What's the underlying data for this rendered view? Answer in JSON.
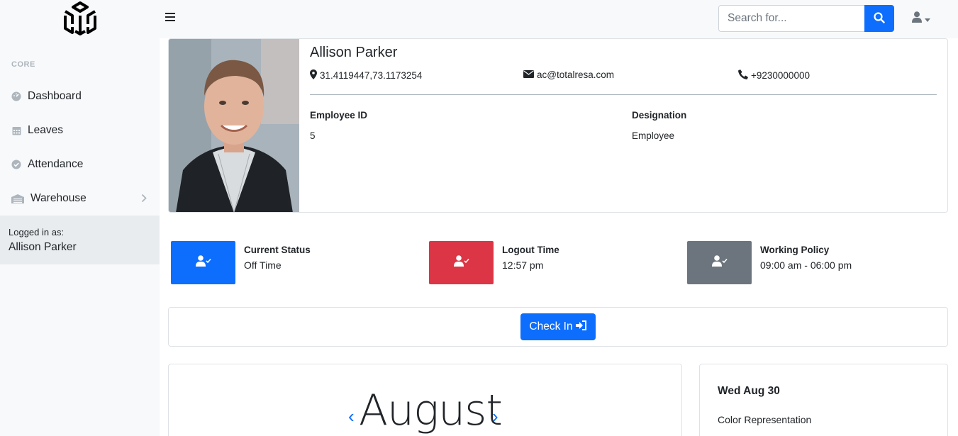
{
  "sidebar": {
    "heading": "CORE",
    "items": [
      {
        "label": "Dashboard",
        "icon": "tachometer-icon"
      },
      {
        "label": "Leaves",
        "icon": "calendar-icon"
      },
      {
        "label": "Attendance",
        "icon": "check-circle-icon"
      },
      {
        "label": "Warehouse",
        "icon": "warehouse-icon"
      }
    ],
    "logged_label": "Logged in as:",
    "logged_user": "Allison Parker"
  },
  "topbar": {
    "search_placeholder": "Search for..."
  },
  "profile": {
    "name": "Allison Parker",
    "location": "31.4119447,73.1173254",
    "email": "ac@totalresa.com",
    "phone": "+9230000000",
    "employee_id_label": "Employee ID",
    "employee_id": "5",
    "designation_label": "Designation",
    "designation": "Employee"
  },
  "status": [
    {
      "title": "Current Status",
      "value": "Off Time",
      "color": "#0d6efd"
    },
    {
      "title": "Logout Time",
      "value": "12:57 pm",
      "color": "#dc3545"
    },
    {
      "title": "Working Policy",
      "value": "09:00 am - 06:00 pm",
      "color": "#6c757d"
    }
  ],
  "checkin": {
    "label": "Check In"
  },
  "calendar": {
    "month": "August",
    "prev": "‹",
    "next": "›"
  },
  "datecard": {
    "date": "Wed Aug 30",
    "color_label": "Color Representation"
  }
}
